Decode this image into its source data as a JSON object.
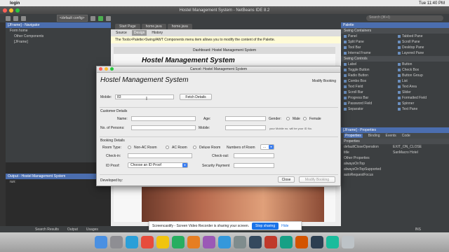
{
  "menubar": {
    "app": "login",
    "time": "Tue 11:40 PM"
  },
  "ide": {
    "title": "Hostel Management System - NetBeans IDE 8.2",
    "config": "<default config>",
    "search_placeholder": "Search (⌘+I)"
  },
  "navigator": {
    "title": "[JFrame] - Navigator",
    "items": [
      "Form home",
      "Other Components",
      "[JFrame]"
    ]
  },
  "output": {
    "title": "Output - Hostel Management System",
    "line": "run:"
  },
  "editor": {
    "tabs": [
      "Start Page",
      "home.java",
      "home.java"
    ],
    "source_label": "Source",
    "design_label": "Design",
    "history_label": "History",
    "info": "The Tools>Palette>Swing/AWT Components menu item allows you to modify the content of the Palette.",
    "bg_title": "Dashboard: Hostel Management System",
    "bg_heading": "Hostel Management System"
  },
  "palette": {
    "title": "Palette",
    "sec1": "Swing Containers",
    "containers": [
      "Panel",
      "Tabbed Pane",
      "Split Pane",
      "Scroll Pane",
      "Tool Bar",
      "Desktop Pane",
      "Internal Frame",
      "Layered Pane"
    ],
    "sec2": "Swing Controls",
    "controls": [
      "Label",
      "Button",
      "Toggle Button",
      "Check Box",
      "Radio Button",
      "Button Group",
      "Combo Box",
      "List",
      "Text Field",
      "Text Area",
      "Scroll Bar",
      "Slider",
      "Progress Bar",
      "Formatted Field",
      "Password Field",
      "Spinner",
      "Separator",
      "Text Pane"
    ]
  },
  "properties": {
    "title": "[JFrame] - Properties",
    "tabs": [
      "Properties",
      "Binding",
      "Events",
      "Code"
    ],
    "section": "Properties",
    "rows": [
      {
        "k": "defaultCloseOperation",
        "v": "EXIT_ON_CLOSE"
      },
      {
        "k": "title",
        "v": "SanMacro Hotel"
      },
      {
        "k": "Other Properties",
        "v": ""
      },
      {
        "k": "alwaysOnTop",
        "v": ""
      },
      {
        "k": "alwaysOnTopSupported",
        "v": ""
      },
      {
        "k": "autoRequestFocus",
        "v": ""
      }
    ]
  },
  "dialog": {
    "title": "Cancel: Hostel Management System",
    "heading": "Hostel Management System",
    "modify_top": "Modify Booking",
    "mobile_label": "Mobile:",
    "mobile_value": "83",
    "fetch_label": "Fetch Details",
    "customer_section": "Customer Details",
    "name_label": "Name:",
    "age_label": "Age:",
    "gender_label": "Gender:",
    "male_label": "Male",
    "female_label": "Female",
    "persons_label": "No. of Persons:",
    "mobile2_label": "Mobile:",
    "mobile_hint": "your Mobile no. will be your ID No.",
    "booking_section": "Booking Details",
    "room_type_label": "Room Type:",
    "non_ac_label": "Non-AC Room",
    "ac_label": "AC Room",
    "deluxe_label": "Deluxe Room",
    "num_rooms_label": "Numbers of Room",
    "num_rooms_value": "...",
    "checkin_label": "Check-in:",
    "checkout_label": "Check-out:",
    "idproof_label": "ID Proof:",
    "idproof_value": "Choose an ID Proof",
    "security_label": "Security Payment",
    "developed_label": "Developed by:",
    "close_label": "Close",
    "modify_label": "Modify Booking"
  },
  "status": {
    "search": "Search Results",
    "output": "Output",
    "usages": "Usages",
    "ins": "INS"
  },
  "notice": {
    "text": "Screencastify - Screen Video Recorder is sharing your screen.",
    "stop": "Stop sharing",
    "hide": "Hide"
  }
}
